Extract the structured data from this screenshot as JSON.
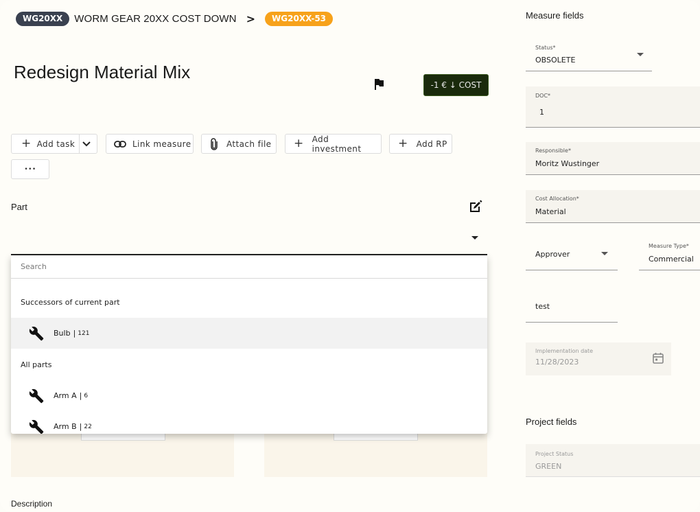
{
  "breadcrumb": {
    "project_chip": "WG20XX",
    "project_title": "WORM GEAR 20XX COST DOWN",
    "separator": ">",
    "measure_chip": "WG20XX-53"
  },
  "measure": {
    "title": "Redesign Material Mix",
    "cost_badge": "-1 € ↓ COST"
  },
  "toolbar": {
    "add_task": "Add task",
    "link_measure": "Link measure",
    "attach_file": "Attach file",
    "add_investment": "Add investment",
    "add_rp": "Add RP",
    "more": "•••"
  },
  "part": {
    "label": "Part",
    "search_placeholder": "Search",
    "group_successors": "Successors of current part",
    "group_all": "All parts",
    "options": [
      {
        "name": "Bulb",
        "sep": "|",
        "num": "121"
      },
      {
        "name": "Arm A",
        "sep": "|",
        "num": "6"
      },
      {
        "name": "Arm B",
        "sep": "|",
        "num": "22"
      }
    ]
  },
  "description_label": "Description",
  "measure_fields": {
    "heading": "Measure fields",
    "status": {
      "label": "Status*",
      "value": "OBSOLETE"
    },
    "doc": {
      "label": "DOC*",
      "value": "1"
    },
    "responsible": {
      "label": "Responsible*",
      "value": "Moritz Wustinger"
    },
    "cost_allocation": {
      "label": "Cost Allocation*",
      "value": "Material"
    },
    "approver": {
      "value": "Approver"
    },
    "measure_type": {
      "label": "Measure Type*",
      "value": "Commercial"
    },
    "test": {
      "value": "test"
    },
    "implementation_date": {
      "label": "Implementation date",
      "value": "11/28/2023"
    }
  },
  "project_fields": {
    "heading": "Project fields",
    "project_status": {
      "label": "Project Status",
      "value": "GREEN"
    }
  }
}
